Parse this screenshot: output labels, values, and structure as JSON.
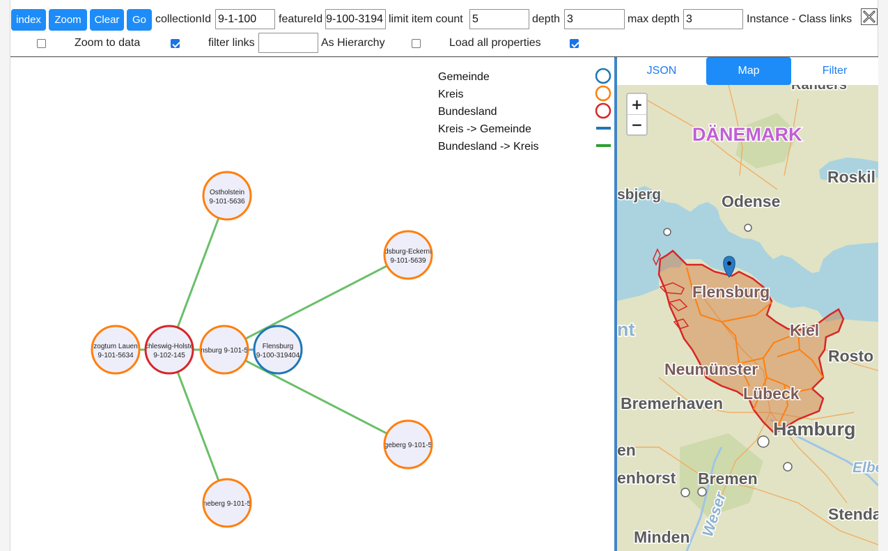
{
  "toolbar": {
    "buttons": {
      "index": "index",
      "zoom": "Zoom",
      "clear": "Clear",
      "go": "Go"
    },
    "collection_label": "collectionId",
    "collection_value": "9-1-100",
    "feature_label": "featureId",
    "feature_value": "9-100-3194",
    "limit_label": "limit item count",
    "limit_value": "5",
    "depth_label": "depth",
    "depth_value": "3",
    "maxdepth_label": "max depth",
    "maxdepth_value": "3",
    "mode_label": "Instance - Class links",
    "close_icon": "close-icon"
  },
  "options": {
    "zoom_to_data_label": "Zoom to data",
    "zoom_to_data_checked": false,
    "filter_links_label": "filter links",
    "filter_links_checked": true,
    "filter_links_value": "",
    "as_hierarchy_label": "As Hierarchy",
    "as_hierarchy_checked": false,
    "load_all_label": "Load all properties",
    "load_all_checked": true
  },
  "legend": [
    {
      "label": "Gemeinde",
      "type": "circle",
      "color": "#1f77b4"
    },
    {
      "label": "Kreis",
      "type": "circle",
      "color": "#ff7f0e"
    },
    {
      "label": "Bundesland",
      "type": "circle",
      "color": "#d62728"
    },
    {
      "label": "Kreis -> Gemeinde",
      "type": "line",
      "color": "#1f77b4"
    },
    {
      "label": "Bundesland -> Kreis",
      "type": "line",
      "color": "#2ca02c"
    }
  ],
  "graph": {
    "nodes": [
      {
        "id": "ostholstein",
        "line1": "Ostholstein",
        "line2": "9-101-5636",
        "kind": "Kreis"
      },
      {
        "id": "rendsburg",
        "line1": "dsburg-Eckernf",
        "line2": "9-101-5639",
        "kind": "Kreis"
      },
      {
        "id": "lauenburg",
        "line1": "zogtum Lauen",
        "line2": "9-101-5634",
        "kind": "Kreis"
      },
      {
        "id": "sh",
        "line1": "chleswig-Holste",
        "line2": "9-102-145",
        "kind": "Bundesland"
      },
      {
        "id": "flensburg-kreis",
        "line1": "nsburg 9-101-5",
        "line2": "",
        "kind": "Kreis"
      },
      {
        "id": "flensburg",
        "line1": "Flensburg",
        "line2": "9-100-319404",
        "kind": "Gemeinde"
      },
      {
        "id": "segeberg",
        "line1": "geberg 9-101-5",
        "line2": "",
        "kind": "Kreis"
      },
      {
        "id": "pinneberg",
        "line1": "neberg 9-101-5",
        "line2": "",
        "kind": "Kreis"
      }
    ],
    "links": [
      {
        "source": "sh",
        "target": "ostholstein",
        "kind": "Bundesland -> Kreis"
      },
      {
        "source": "sh",
        "target": "lauenburg",
        "kind": "Bundesland -> Kreis"
      },
      {
        "source": "sh",
        "target": "flensburg-kreis",
        "kind": "Bundesland -> Kreis"
      },
      {
        "source": "sh",
        "target": "pinneberg",
        "kind": "Bundesland -> Kreis"
      },
      {
        "source": "flensburg-kreis",
        "target": "rendsburg",
        "kind": "Bundesland -> Kreis"
      },
      {
        "source": "flensburg-kreis",
        "target": "segeberg",
        "kind": "Bundesland -> Kreis"
      },
      {
        "source": "flensburg-kreis",
        "target": "flensburg",
        "kind": "Kreis -> Gemeinde"
      }
    ]
  },
  "panel": {
    "tabs": [
      {
        "label": "JSON",
        "active": false
      },
      {
        "label": "Map",
        "active": true
      },
      {
        "label": "Filter",
        "active": false
      }
    ],
    "map": {
      "zoom_in": "+",
      "zoom_out": "−",
      "labels": {
        "randers": "Randers",
        "daenemark": "DÄNEMARK",
        "roskilde": "Roskil",
        "esbjerg": "sbjerg",
        "odense": "Odense",
        "flensburg": "Flensburg",
        "nt": "nt",
        "kiel": "Kiel",
        "neumuenster": "Neumünster",
        "rostock": "Rosto",
        "bremerhaven": "Bremerhaven",
        "luebeck": "Lübeck",
        "hamburg": "Hamburg",
        "en": "en",
        "elbe": "Elbe",
        "enhorst": "enhorst",
        "bremen": "Bremen",
        "weser": "Weser",
        "stendal": "Stendal",
        "minden": "Minden"
      }
    }
  }
}
